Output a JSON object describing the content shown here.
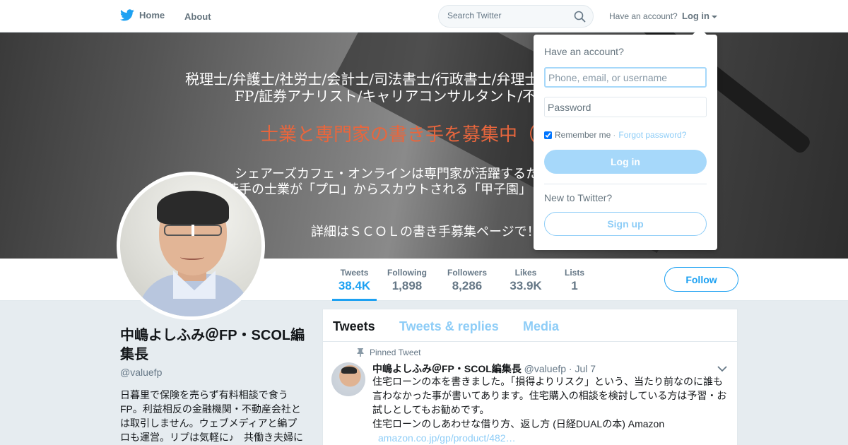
{
  "nav": {
    "home_label": "Home",
    "about_label": "About",
    "search_placeholder": "Search Twitter",
    "have_account": "Have an account?",
    "login_label": "Log in",
    "brand_color": "#1da1f2",
    "bird_icon": "twitter-bird-icon"
  },
  "banner": {
    "line1": "税理士/弁護士/社労士/会計士/司法書士/行政書士/弁理士",
    "line2": "FP/証券アナリスト/キャリアコンサルタント/不動",
    "line3": "士業と専門家の書き手を募集中（＊・ω",
    "line4": "シェアーズカフェ・オンラインは専門家が活躍するた",
    "line5": "若手の士業が「プロ」からスカウトされる「甲子園」",
    "line6": "詳細はＳＣＯＬの書き手募集ページで！"
  },
  "stats": [
    {
      "label": "Tweets",
      "value": "38.4K"
    },
    {
      "label": "Following",
      "value": "1,898"
    },
    {
      "label": "Followers",
      "value": "8,286"
    },
    {
      "label": "Likes",
      "value": "33.9K"
    },
    {
      "label": "Lists",
      "value": "1"
    }
  ],
  "follow_label": "Follow",
  "profile": {
    "name": "中嶋よしふみ＠FP・SCOL編集長",
    "handle": "@valuefp",
    "bio": "日暮里で保険を売らず有料相談で食うFP。利益相反の金融機関・不動産会社とは取引しません。ウェブメディアと編プロも運営。リプは気軽に♪　共働き夫婦に"
  },
  "timeline": {
    "tabs": [
      "Tweets",
      "Tweets & replies",
      "Media"
    ],
    "pinned_label": "Pinned Tweet",
    "tweet": {
      "name": "中嶋よしふみ＠FP・SCOL編集長",
      "handle": "@valuefp",
      "date": "· Jul 7",
      "text1": "住宅ローンの本を書きました。「損得よりリスク」という、当たり前なのに誰も言わなかった事が書いてあります。住宅購入の相談を検討している方は予習・お試しとしてもお勧めです。",
      "text2": "住宅ローンのしあわせな借り方、返し方 (日経DUALの本) Amazon",
      "link": "amazon.co.jp/gp/product/482…"
    }
  },
  "login_dropdown": {
    "title": "Have an account?",
    "user_placeholder": "Phone, email, or username",
    "password_placeholder": "Password",
    "remember_label": "Remember me",
    "forgot_label": "Forgot password?",
    "login_button": "Log in",
    "new_label": "New to Twitter?",
    "signup_button": "Sign up"
  }
}
